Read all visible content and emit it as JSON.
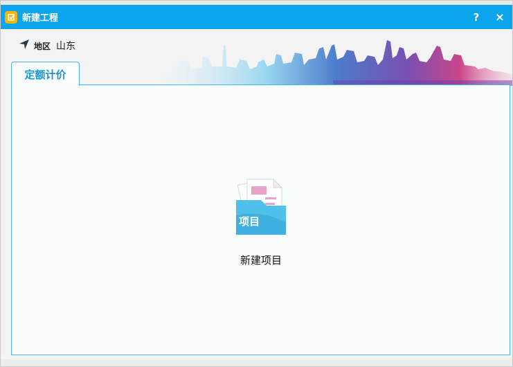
{
  "window": {
    "title": "新建工程",
    "help_label": "?",
    "close_label": "×"
  },
  "region": {
    "label": "地区",
    "value": "山东"
  },
  "tabs": [
    {
      "label": "定额计价",
      "active": true
    }
  ],
  "project": {
    "icon_text": "项目",
    "caption": "新建项目"
  },
  "colors": {
    "titlebar": "#0aa5ec",
    "accent": "#45b4e7",
    "tab_text": "#1597d6",
    "folder": "#4fc0ea",
    "doc_pink": "#e7a2c8"
  },
  "icons": {
    "app": "app-logo-icon",
    "region": "location-arrow-icon",
    "project": "folder-document-icon"
  }
}
